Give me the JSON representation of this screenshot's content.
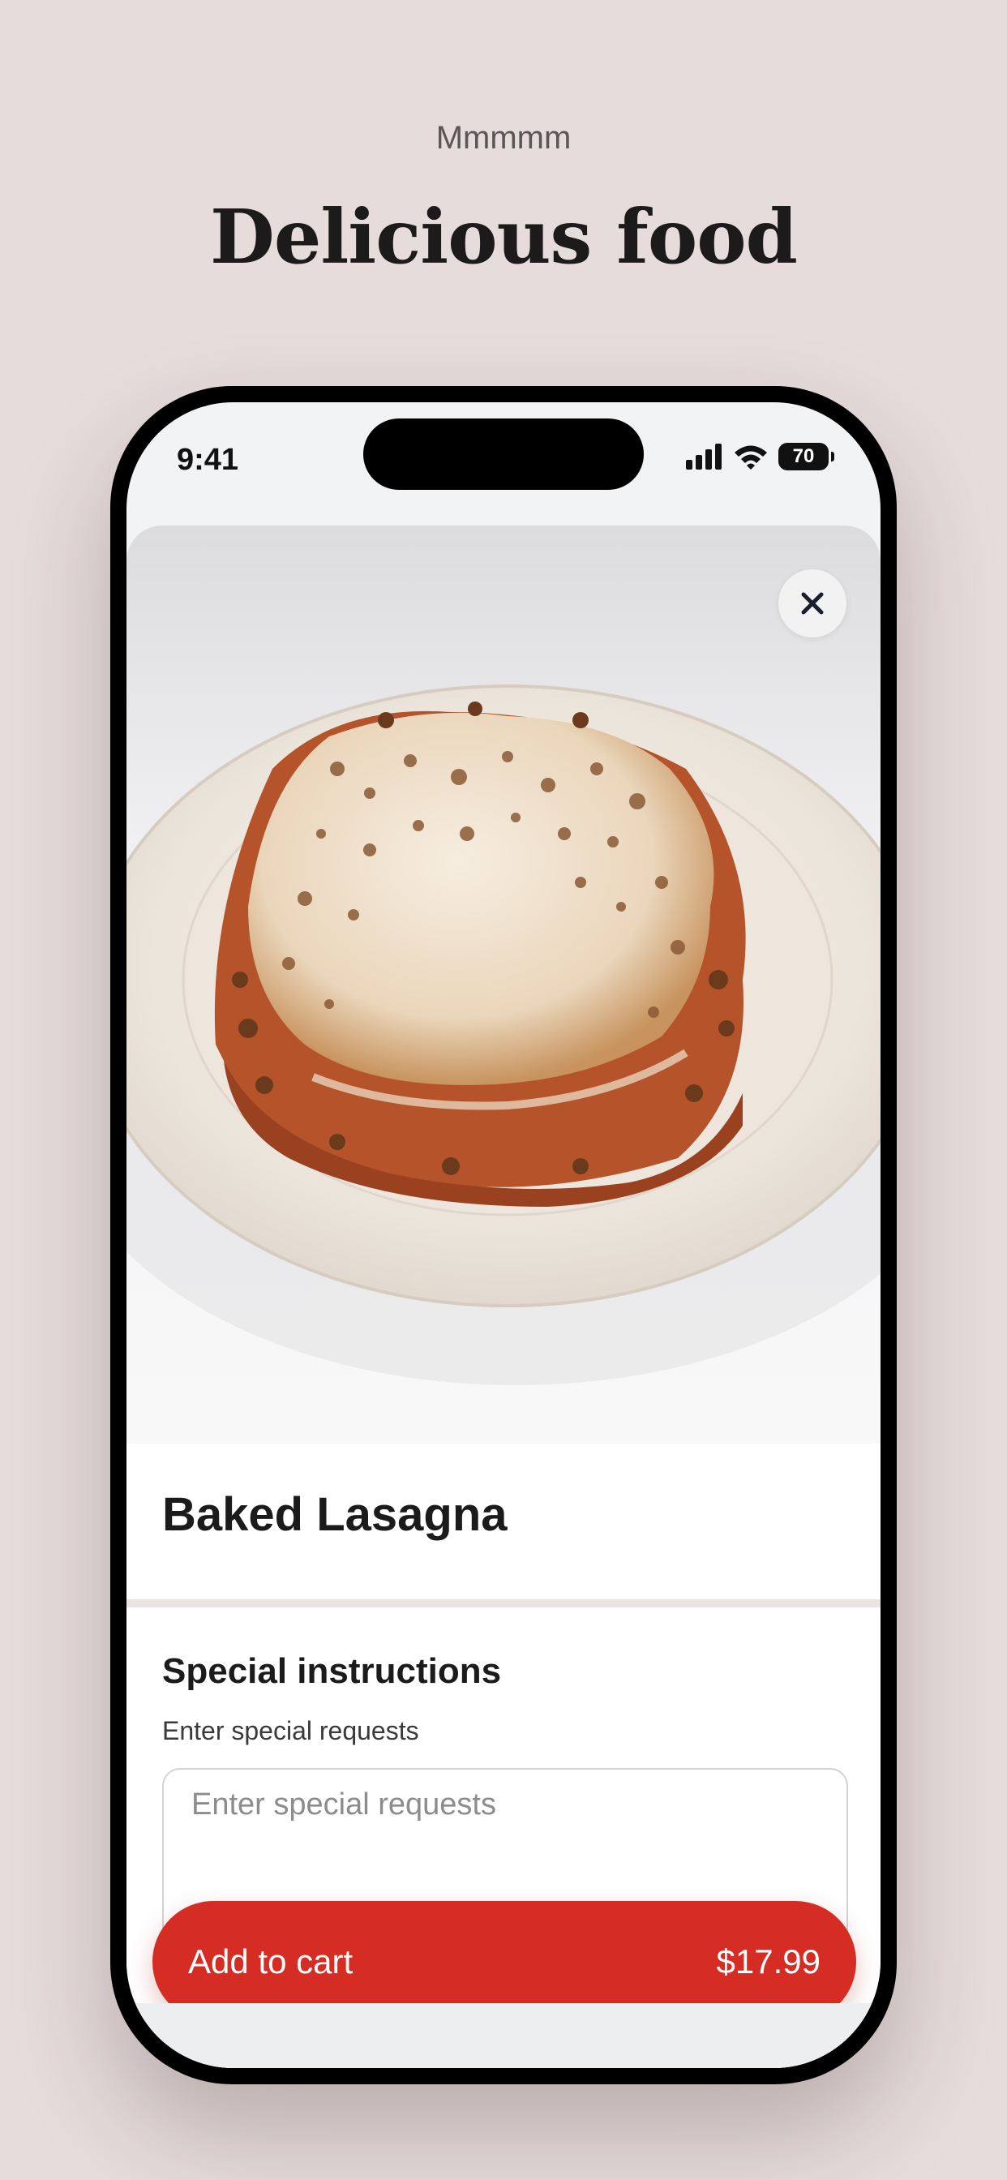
{
  "promo": {
    "eyebrow": "Mmmmm",
    "title": "Delicious food"
  },
  "status_bar": {
    "time": "9:41",
    "battery": "70",
    "icons": [
      "signal-icon",
      "wifi-icon",
      "battery-icon"
    ]
  },
  "item": {
    "photo_icon": "lasagna-photo",
    "name": "Baked Lasagna"
  },
  "instructions": {
    "title": "Special instructions",
    "subtitle": "Enter special requests",
    "placeholder": "Enter special requests"
  },
  "cart": {
    "label": "Add to cart",
    "price": "$17.99"
  },
  "colors": {
    "background": "#e6dcdb",
    "accent": "#d52d24"
  }
}
